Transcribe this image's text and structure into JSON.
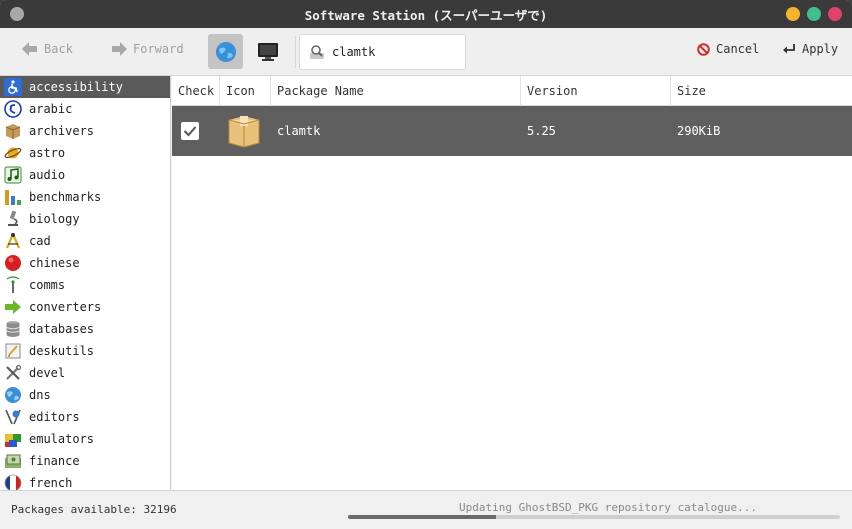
{
  "window": {
    "title": "Software Station (スーパーユーザで)",
    "controls": {
      "minimize_color": "#f5b42a",
      "maximize_color": "#3fbf8f",
      "close_color": "#e0436a"
    }
  },
  "toolbar": {
    "back_label": "Back",
    "forward_label": "Forward",
    "cancel_label": "Cancel",
    "apply_label": "Apply",
    "search": {
      "value": "clamtk",
      "placeholder": ""
    }
  },
  "sidebar": {
    "items": [
      {
        "label": "accessibility",
        "icon": "wheelchair-icon",
        "selected": true
      },
      {
        "label": "arabic",
        "icon": "arabic-letter-icon"
      },
      {
        "label": "archivers",
        "icon": "box-icon"
      },
      {
        "label": "astro",
        "icon": "planet-icon"
      },
      {
        "label": "audio",
        "icon": "music-note-icon"
      },
      {
        "label": "benchmarks",
        "icon": "bar-graph-icon"
      },
      {
        "label": "biology",
        "icon": "microscope-icon"
      },
      {
        "label": "cad",
        "icon": "compass-icon"
      },
      {
        "label": "chinese",
        "icon": "red-circle-icon"
      },
      {
        "label": "comms",
        "icon": "antenna-icon"
      },
      {
        "label": "converters",
        "icon": "green-arrow-icon"
      },
      {
        "label": "databases",
        "icon": "database-icon"
      },
      {
        "label": "deskutils",
        "icon": "notepad-icon"
      },
      {
        "label": "devel",
        "icon": "tools-icon"
      },
      {
        "label": "dns",
        "icon": "globe-icon"
      },
      {
        "label": "editors",
        "icon": "editor-icon"
      },
      {
        "label": "emulators",
        "icon": "game-controller-icon"
      },
      {
        "label": "finance",
        "icon": "money-icon"
      },
      {
        "label": "french",
        "icon": "french-flag-icon"
      }
    ]
  },
  "table": {
    "headers": {
      "check": "Check",
      "icon": "Icon",
      "name": "Package Name",
      "version": "Version",
      "size": "Size"
    },
    "rows": [
      {
        "checked": true,
        "icon": "package-box-icon",
        "name": "clamtk",
        "version": "5.25",
        "size": "290KiB"
      }
    ]
  },
  "status": {
    "packages_available": "Packages available: 32196",
    "progress_text": "Updating GhostBSD_PKG repository catalogue...",
    "progress_fraction": 0.3
  }
}
